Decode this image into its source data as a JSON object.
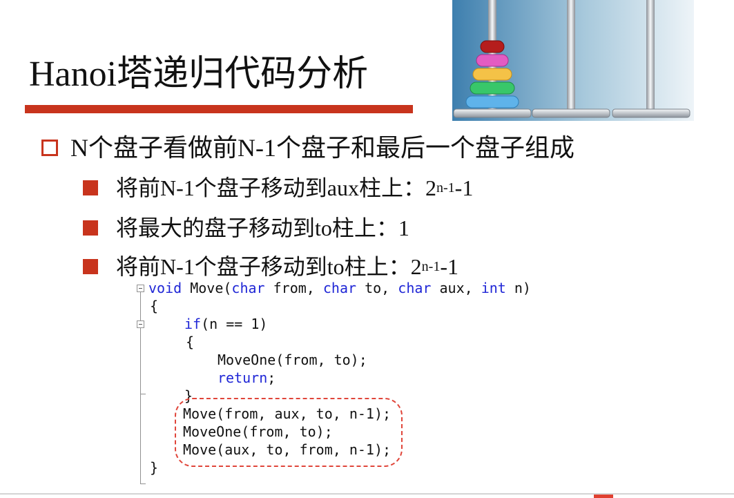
{
  "slide": {
    "title": "Hanoi塔递归代码分析",
    "level1_bullet": "N个盘子看做前N-1个盘子和最后一个盘子组成",
    "level2_bullets": [
      {
        "text": "将前N-1个盘子移动到aux柱上：",
        "formula_base": "2",
        "formula_exp": "n-1",
        "formula_tail": "-1"
      },
      {
        "text": "将最大的盘子移动到to柱上：",
        "formula_base": "1",
        "formula_exp": "",
        "formula_tail": ""
      },
      {
        "text": "将前N-1个盘子移动到to柱上：",
        "formula_base": "2",
        "formula_exp": "n-1",
        "formula_tail": "-1"
      }
    ]
  },
  "code": {
    "line1": {
      "kw1": "void",
      "t1": " Move(",
      "kw2": "char",
      "t2": " from, ",
      "kw3": "char",
      "t3": " to, ",
      "kw4": "char",
      "t4": " aux, ",
      "kw5": "int",
      "t5": " n)"
    },
    "line2": "{",
    "line3": {
      "kw": "if",
      "text": "(n == 1)"
    },
    "line4": "{",
    "line5": "MoveOne(from, to);",
    "line6": {
      "kw": "return",
      "text": ";"
    },
    "line7": "}",
    "line8": "Move(from, aux, to, n-1);",
    "line9": "MoveOne(from, to);",
    "line10": "Move(aux, to, from, n-1);",
    "line11": "}"
  },
  "colors": {
    "accent": "#c8341d",
    "keyword": "#1f26d6",
    "highlight": "#e0453a"
  },
  "icons": {
    "level1_bullet": "hollow-square-icon",
    "level2_bullet": "filled-square-icon",
    "image": "tower-of-hanoi-illustration"
  }
}
